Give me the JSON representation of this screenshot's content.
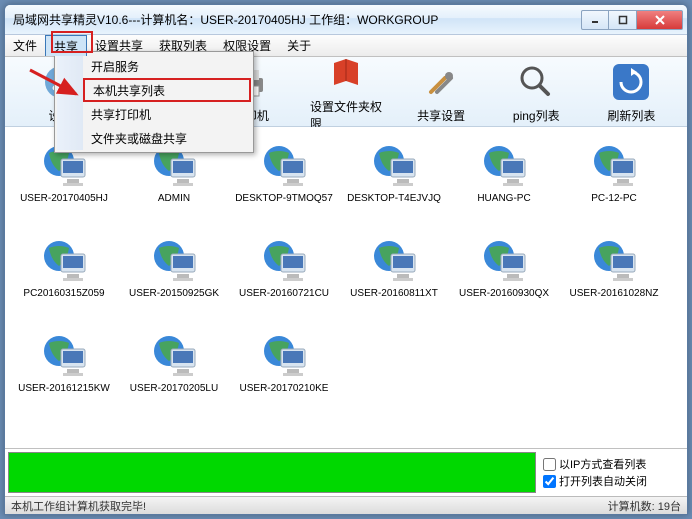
{
  "title": "局域网共享精灵V10.6---计算机名：USER-20170405HJ  工作组：WORKGROUP",
  "menubar": [
    "文件",
    "共享",
    "设置共享",
    "获取列表",
    "权限设置",
    "关于"
  ],
  "open_menu_index": 1,
  "dropdown": [
    "开启服务",
    "本机共享列表",
    "共享打印机",
    "文件夹或磁盘共享"
  ],
  "dropdown_highlight_index": 1,
  "toolbar": [
    {
      "label": "设…",
      "icon": "wrench"
    },
    {
      "label": "…",
      "icon": "screen"
    },
    {
      "label": "打印机",
      "icon": "printer"
    },
    {
      "label": "设置文件夹权限",
      "icon": "book"
    },
    {
      "label": "共享设置",
      "icon": "tools"
    },
    {
      "label": "ping列表",
      "icon": "magnifier"
    },
    {
      "label": "刷新列表",
      "icon": "refresh"
    }
  ],
  "computers": [
    "USER-20170405HJ",
    "ADMIN",
    "DESKTOP-9TMOQ57",
    "DESKTOP-T4EJVJQ",
    "HUANG-PC",
    "PC-12-PC",
    "PC20160315Z059",
    "USER-20150925GK",
    "USER-20160721CU",
    "USER-20160811XT",
    "USER-20160930QX",
    "USER-20161028NZ",
    "USER-20161215KW",
    "USER-20170205LU",
    "USER-20170210KE"
  ],
  "footer": {
    "checkbox_ip": "以IP方式查看列表",
    "checkbox_auto": "打开列表自动关闭",
    "checkbox_ip_checked": false,
    "checkbox_auto_checked": true
  },
  "status": {
    "left": "本机工作组计算机获取完毕!",
    "right": "计算机数: 19台"
  }
}
